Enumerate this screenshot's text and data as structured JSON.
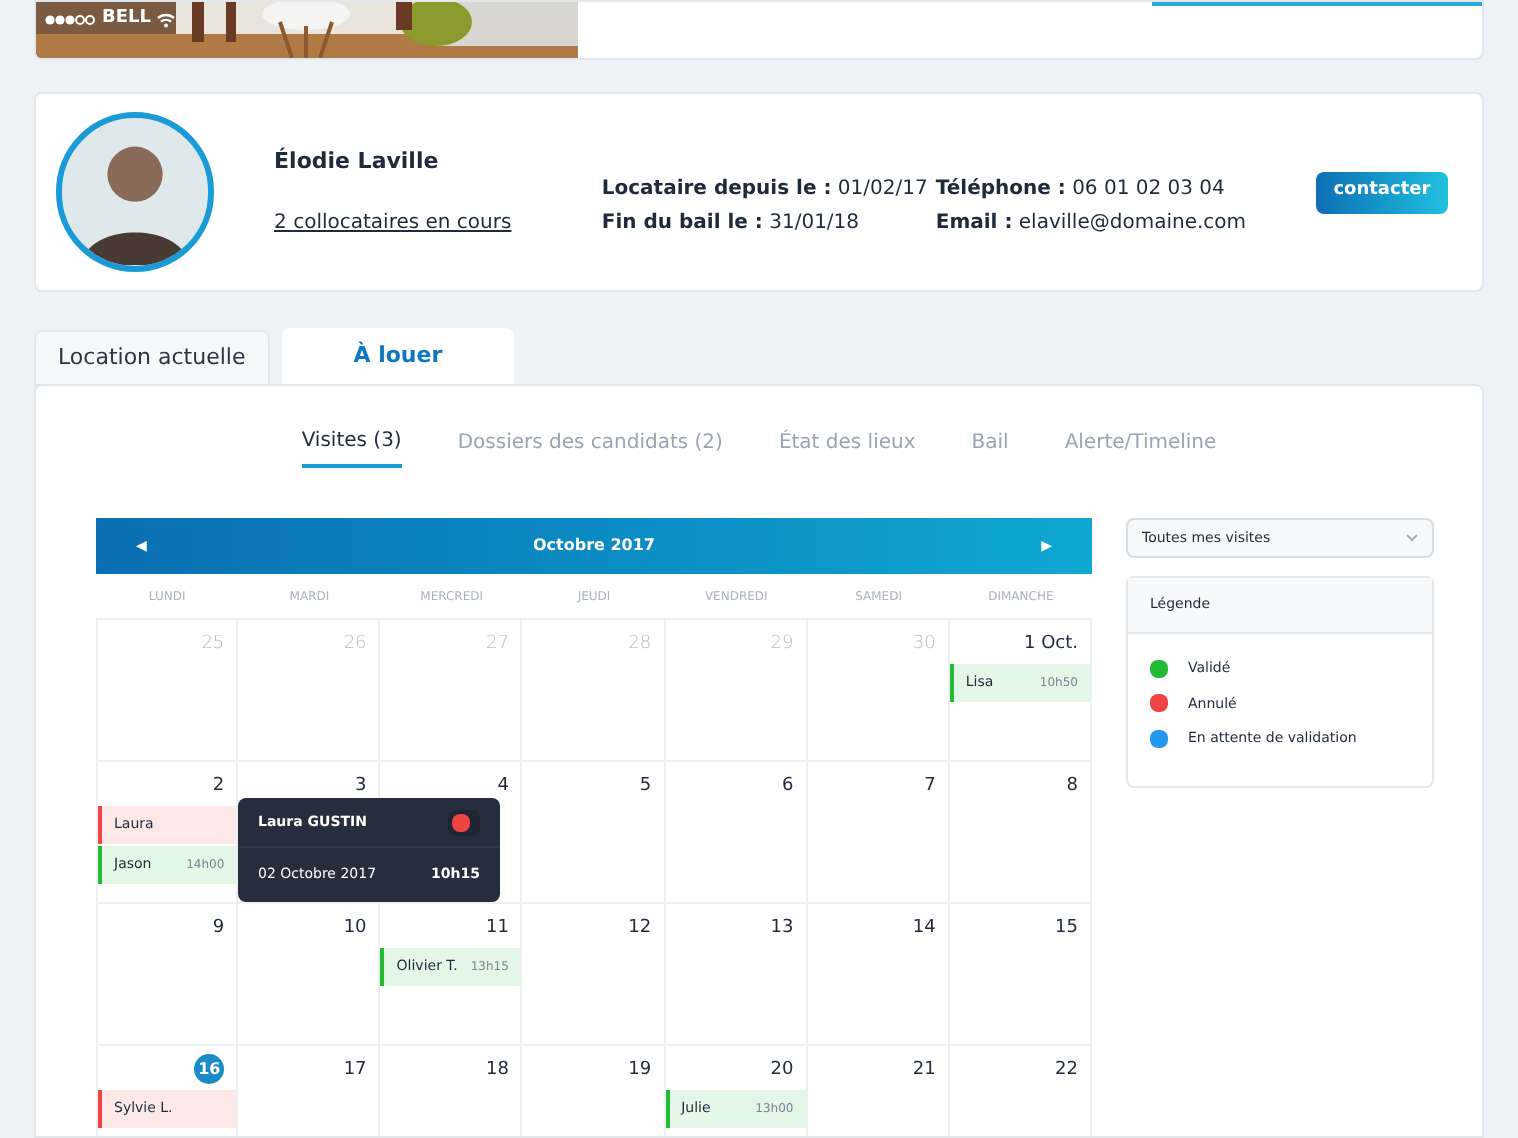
{
  "status_bar": {
    "carrier": "BELL"
  },
  "profile": {
    "name": "Élodie Laville",
    "roommates_link": "2 collocataires en cours",
    "fields": [
      {
        "label": "Locataire depuis le :",
        "value": "01/02/17"
      },
      {
        "label": "Fin du bail le  :",
        "value": "31/01/18"
      },
      {
        "label": "Téléphone :",
        "value": "06 01 02 03 04"
      },
      {
        "label": "Email :",
        "value": "elaville@domaine.com"
      }
    ],
    "contact_button": "contacter"
  },
  "tabs": [
    {
      "label": "Location actuelle",
      "selected": false
    },
    {
      "label": "À louer",
      "selected": true
    }
  ],
  "subtabs": [
    {
      "label": "Visites (3)",
      "selected": true
    },
    {
      "label": "Dossiers des candidats (2)",
      "selected": false
    },
    {
      "label": "État des lieux",
      "selected": false
    },
    {
      "label": "Bail",
      "selected": false
    },
    {
      "label": "Alerte/Timeline",
      "selected": false
    }
  ],
  "calendar": {
    "prev": "◀",
    "month": "Octobre 2017",
    "next": "▶",
    "weekdays": [
      "LUNDI",
      "MARDI",
      "MERCREDI",
      "JEUDI",
      "VENDREDI",
      "SAMEDI",
      "DIMANCHE"
    ],
    "weeks": [
      [
        {
          "day": "25",
          "muted": true
        },
        {
          "day": "26",
          "muted": true
        },
        {
          "day": "27",
          "muted": true
        },
        {
          "day": "28",
          "muted": true
        },
        {
          "day": "29",
          "muted": true
        },
        {
          "day": "30",
          "muted": true
        },
        {
          "day": "1 Oct.",
          "muted": false,
          "events": [
            {
              "name": "Lisa",
              "time": "10h50",
              "color": "#22bb33"
            }
          ]
        }
      ],
      [
        {
          "day": "2",
          "muted": false,
          "events": [
            {
              "name": "Laura",
              "color": "#ee4444"
            },
            {
              "name": "Jason",
              "time": "14h00",
              "color": "#22bb33"
            }
          ]
        },
        {
          "day": "3",
          "muted": false
        },
        {
          "day": "4",
          "muted": false
        },
        {
          "day": "5",
          "muted": false
        },
        {
          "day": "6",
          "muted": false
        },
        {
          "day": "7",
          "muted": false
        },
        {
          "day": "8",
          "muted": false
        }
      ],
      [
        {
          "day": "9",
          "muted": false
        },
        {
          "day": "10",
          "muted": false
        },
        {
          "day": "11",
          "muted": false,
          "events": [
            {
              "name": "Olivier T.",
              "time": "13h15",
              "color": "#22bb33"
            }
          ]
        },
        {
          "day": "12",
          "muted": false
        },
        {
          "day": "13",
          "muted": false
        },
        {
          "day": "14",
          "muted": false
        },
        {
          "day": "15",
          "muted": false
        }
      ],
      [
        {
          "day": "16",
          "muted": false,
          "today": true,
          "events": [
            {
              "name": "Sylvie L.",
              "color": "#ee4444"
            }
          ]
        },
        {
          "day": "17",
          "muted": false
        },
        {
          "day": "18",
          "muted": false
        },
        {
          "day": "19",
          "muted": false
        },
        {
          "day": "20",
          "muted": false,
          "events": [
            {
              "name": "Julie",
              "time": "13h00",
              "color": "#22bb33"
            }
          ]
        },
        {
          "day": "21",
          "muted": false
        },
        {
          "day": "22",
          "muted": false
        }
      ]
    ],
    "popover": {
      "name": "Laura GUSTIN",
      "color": "#ee4444",
      "date": "02 Octobre 2017",
      "time": "10h15"
    }
  },
  "filter": {
    "value": "Toutes mes visites"
  },
  "legend": {
    "title": "Légende",
    "items": [
      {
        "label": "Validé",
        "color": "#22bb33"
      },
      {
        "label": "Annulé",
        "color": "#ee4444"
      },
      {
        "label": "En attente de validation",
        "color": "#2299ee"
      }
    ]
  }
}
